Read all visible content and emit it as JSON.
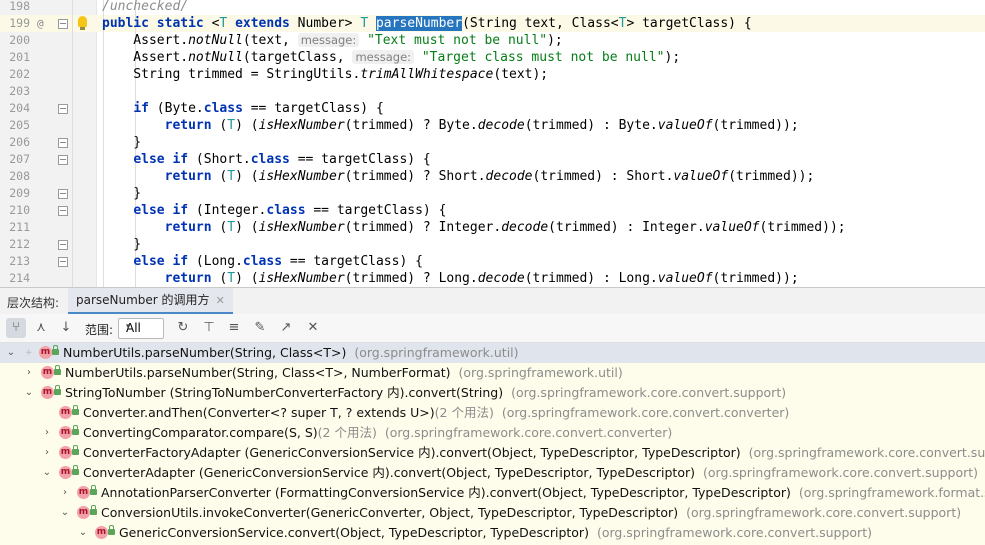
{
  "editor": {
    "lines": [
      {
        "num": "198",
        "html": "<span class=\"cmt\">/unchecked/</span>"
      },
      {
        "num": "199",
        "ann": "@",
        "current": true,
        "bulb": true,
        "html": "<span class=\"kw\">public static</span> &lt;<span class=\"tp\">T</span> <span class=\"kw\">extends</span> Number&gt; <span class=\"tp\">T</span> <span class=\"sel\">parseNumber</span>(String text, Class&lt;<span class=\"tp\">T</span>&gt; targetClass) {"
      },
      {
        "num": "200",
        "html": "    Assert.<span class=\"it\">notNull</span>(text, <span class=\"hint\">message:</span> <span class=\"str\">\"Text must not be null\"</span>);"
      },
      {
        "num": "201",
        "html": "    Assert.<span class=\"it\">notNull</span>(targetClass, <span class=\"hint\">message:</span> <span class=\"str\">\"Target class must not be null\"</span>);"
      },
      {
        "num": "202",
        "html": "    String trimmed = StringUtils.<span class=\"it\">trimAllWhitespace</span>(text);"
      },
      {
        "num": "203",
        "html": ""
      },
      {
        "num": "204",
        "fold": true,
        "html": "    <span class=\"kw\">if</span> (Byte.<span class=\"kw\">class</span> == targetClass) {"
      },
      {
        "num": "205",
        "html": "        <span class=\"kw\">return</span> (<span class=\"tp\">T</span>) (<span class=\"it\">isHexNumber</span>(trimmed) ? Byte.<span class=\"it\">decode</span>(trimmed) : Byte.<span class=\"it\">valueOf</span>(trimmed));"
      },
      {
        "num": "206",
        "fold": true,
        "html": "    }"
      },
      {
        "num": "207",
        "fold": true,
        "html": "    <span class=\"kw\">else if</span> (Short.<span class=\"kw\">class</span> == targetClass) {"
      },
      {
        "num": "208",
        "html": "        <span class=\"kw\">return</span> (<span class=\"tp\">T</span>) (<span class=\"it\">isHexNumber</span>(trimmed) ? Short.<span class=\"it\">decode</span>(trimmed) : Short.<span class=\"it\">valueOf</span>(trimmed));"
      },
      {
        "num": "209",
        "fold": true,
        "html": "    }"
      },
      {
        "num": "210",
        "fold": true,
        "html": "    <span class=\"kw\">else if</span> (Integer.<span class=\"kw\">class</span> == targetClass) {"
      },
      {
        "num": "211",
        "html": "        <span class=\"kw\">return</span> (<span class=\"tp\">T</span>) (<span class=\"it\">isHexNumber</span>(trimmed) ? Integer.<span class=\"it\">decode</span>(trimmed) : Integer.<span class=\"it\">valueOf</span>(trimmed));"
      },
      {
        "num": "212",
        "fold": true,
        "html": "    }"
      },
      {
        "num": "213",
        "fold": true,
        "html": "    <span class=\"kw\">else if</span> (Long.<span class=\"kw\">class</span> == targetClass) {"
      },
      {
        "num": "214",
        "html": "        <span class=\"kw\">return</span> (<span class=\"tp\">T</span>) (<span class=\"it\">isHexNumber</span>(trimmed) ? Long.<span class=\"it\">decode</span>(trimmed) : Long.<span class=\"it\">valueOf</span>(trimmed));"
      }
    ]
  },
  "toolwindow": {
    "title": "层次结构:",
    "tab_label": "parseNumber 的调用方",
    "tab_close": "✕"
  },
  "toolbar": {
    "scope_label": "范围:",
    "scope_value": "All",
    "buttons": [
      {
        "name": "caller-hierarchy-button",
        "glyph": "⑂",
        "on": true
      },
      {
        "name": "callee-hierarchy-button",
        "glyph": "⋏",
        "on": false
      },
      {
        "name": "sort-alphabetically-button",
        "glyph": "↓",
        "on": false
      },
      {
        "name": "refresh-button",
        "glyph": "↻",
        "on": false
      },
      {
        "name": "filter-button",
        "glyph": "⊤",
        "on": false
      },
      {
        "name": "expand-all-button",
        "glyph": "≡",
        "on": false
      },
      {
        "name": "pin-tab-button",
        "glyph": "✎",
        "on": false
      },
      {
        "name": "open-in-editor-button",
        "glyph": "↗",
        "on": false
      },
      {
        "name": "close-button",
        "glyph": "✕",
        "on": false
      }
    ]
  },
  "tree": {
    "rows": [
      {
        "depth": 0,
        "arrow": "expanded",
        "root": true,
        "selected": true,
        "method": "NumberUtils.parseNumber(String, Class<T>)",
        "count": "",
        "pkg": "(org.springframework.util)"
      },
      {
        "depth": 1,
        "arrow": "collapsed",
        "method": "NumberUtils.parseNumber(String, Class<T>, NumberFormat)",
        "count": "",
        "pkg": "(org.springframework.util)"
      },
      {
        "depth": 1,
        "arrow": "expanded",
        "method": "StringToNumber (StringToNumberConverterFactory 内).convert(String)",
        "count": "",
        "pkg": "(org.springframework.core.convert.support)"
      },
      {
        "depth": 2,
        "arrow": "none",
        "method": "Converter.andThen(Converter<? super T, ? extends U>)",
        "count": "(2 个用法)",
        "pkg": "(org.springframework.core.convert.converter)"
      },
      {
        "depth": 2,
        "arrow": "collapsed",
        "method": "ConvertingComparator.compare(S, S)",
        "count": "(2 个用法)",
        "pkg": "(org.springframework.core.convert.converter)"
      },
      {
        "depth": 2,
        "arrow": "collapsed",
        "method": "ConverterFactoryAdapter (GenericConversionService 内).convert(Object, TypeDescriptor, TypeDescriptor)",
        "count": "",
        "pkg": "(org.springframework.core.convert.support)"
      },
      {
        "depth": 2,
        "arrow": "expanded",
        "method": "ConverterAdapter (GenericConversionService 内).convert(Object, TypeDescriptor, TypeDescriptor)",
        "count": "",
        "pkg": "(org.springframework.core.convert.support)"
      },
      {
        "depth": 3,
        "arrow": "collapsed",
        "method": "AnnotationParserConverter (FormattingConversionService 内).convert(Object, TypeDescriptor, TypeDescriptor)",
        "count": "",
        "pkg": "(org.springframework.format.support)"
      },
      {
        "depth": 3,
        "arrow": "expanded",
        "method": "ConversionUtils.invokeConverter(GenericConverter, Object, TypeDescriptor, TypeDescriptor)",
        "count": "",
        "pkg": "(org.springframework.core.convert.support)"
      },
      {
        "depth": 4,
        "arrow": "expanded",
        "method": "GenericConversionService.convert(Object, TypeDescriptor, TypeDescriptor)",
        "count": "",
        "pkg": "(org.springframework.core.convert.support)"
      }
    ]
  },
  "icons": {
    "method": "m",
    "expanded": "⌄",
    "collapsed": "›",
    "dropdown": "▾"
  }
}
